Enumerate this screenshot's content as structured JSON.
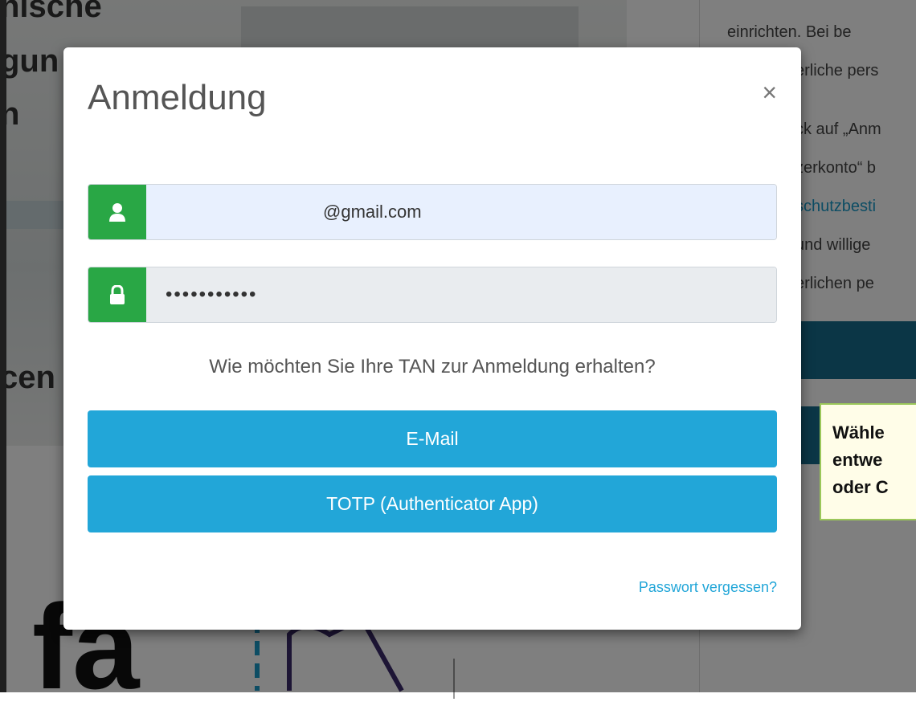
{
  "background": {
    "headings": [
      "nische",
      "gun",
      "n",
      "cen"
    ],
    "right_text": [
      "einrichten. Bei be",
      "erliche pers",
      "ck auf „Anm",
      "zerkonto“ b",
      "schutzbesti",
      "und willige",
      "erlichen pe"
    ],
    "callout_lines": [
      "Wähle",
      "entwe",
      "oder C"
    ],
    "logo_text": "fa"
  },
  "modal": {
    "title": "Anmeldung",
    "close_label": "×",
    "email_value": "@gmail.com",
    "password_value": "•••••••••••",
    "tan_question": "Wie möchten Sie Ihre TAN zur Anmeldung erhalten?",
    "email_button": "E-Mail",
    "totp_button": "TOTP (Authenticator App)",
    "forgot_link": "Passwort vergessen?"
  },
  "colors": {
    "accent": "#22a6d8",
    "addon_green": "#29a745",
    "dark_bar": "#176d8c"
  },
  "icons": [
    "user-icon",
    "lock-icon",
    "close-icon"
  ]
}
